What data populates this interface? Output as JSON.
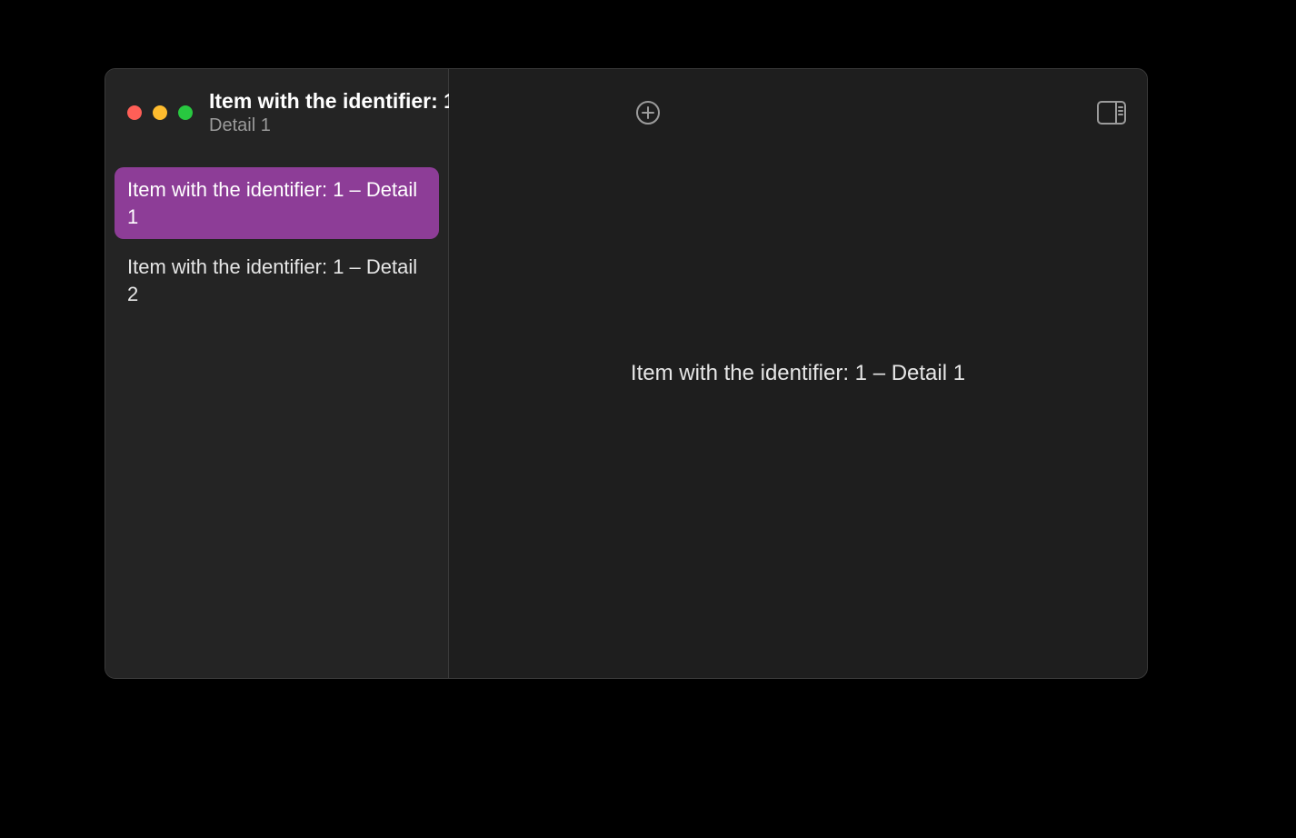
{
  "window": {
    "title": "Item with the identifier:  1",
    "subtitle": "Detail 1"
  },
  "sidebar": {
    "items": [
      {
        "label": "Item with the identifier:  1 – Detail 1",
        "selected": true
      },
      {
        "label": "Item with the identifier:  1 – Detail 2",
        "selected": false
      }
    ]
  },
  "toolbar": {
    "add_icon": "plus-circle-icon",
    "sidebar_toggle_icon": "sidebar-right-icon"
  },
  "content": {
    "detail_text": "Item with the identifier:  1 – Detail 1"
  },
  "colors": {
    "selection": "#8d3d97",
    "window_bg": "#1e1e1e",
    "sidebar_bg": "#242424"
  }
}
